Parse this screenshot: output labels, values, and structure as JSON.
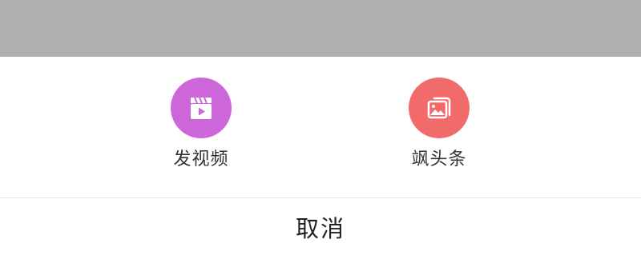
{
  "actions": [
    {
      "label": "发视频",
      "icon": "video-clapper-icon",
      "color": "#cc66d9"
    },
    {
      "label": "飒头条",
      "icon": "photo-stack-icon",
      "color": "#f26b6b"
    }
  ],
  "cancel_label": "取消",
  "colors": {
    "scrim": "#b0b0b0",
    "sheet": "#ffffff",
    "divider": "#e6e6e6"
  }
}
